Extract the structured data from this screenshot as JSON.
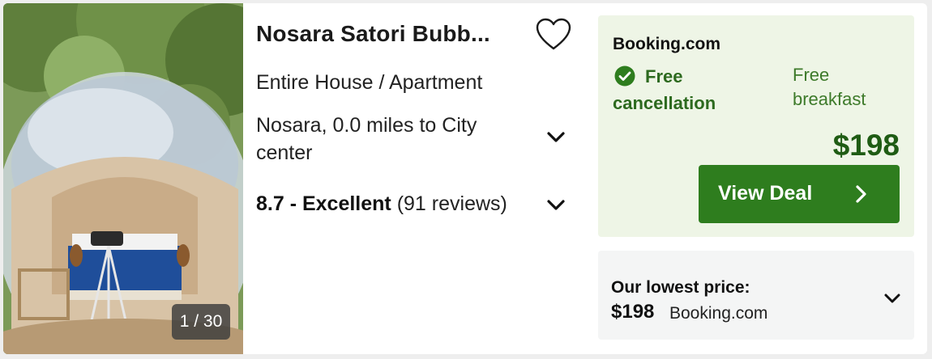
{
  "listing": {
    "title": "Nosara Satori Bubb...",
    "type": "Entire House / Apartment",
    "location": "Nosara, 0.0 miles to City center",
    "rating_score": "8.7 - Excellent",
    "rating_reviews": "(91 reviews)",
    "photo_counter": "1 / 30",
    "favorite_icon": "heart-outline-icon"
  },
  "deal": {
    "provider": "Booking.com",
    "free_cancellation": "Free cancellation",
    "free_breakfast": "Free breakfast",
    "price": "$198",
    "button_label": "View Deal"
  },
  "lowest": {
    "label": "Our lowest price:",
    "price": "$198",
    "provider": "Booking.com"
  },
  "colors": {
    "accent_green": "#2e7d1e",
    "deal_background": "#eef5e6",
    "price_green": "#1f5c14"
  }
}
